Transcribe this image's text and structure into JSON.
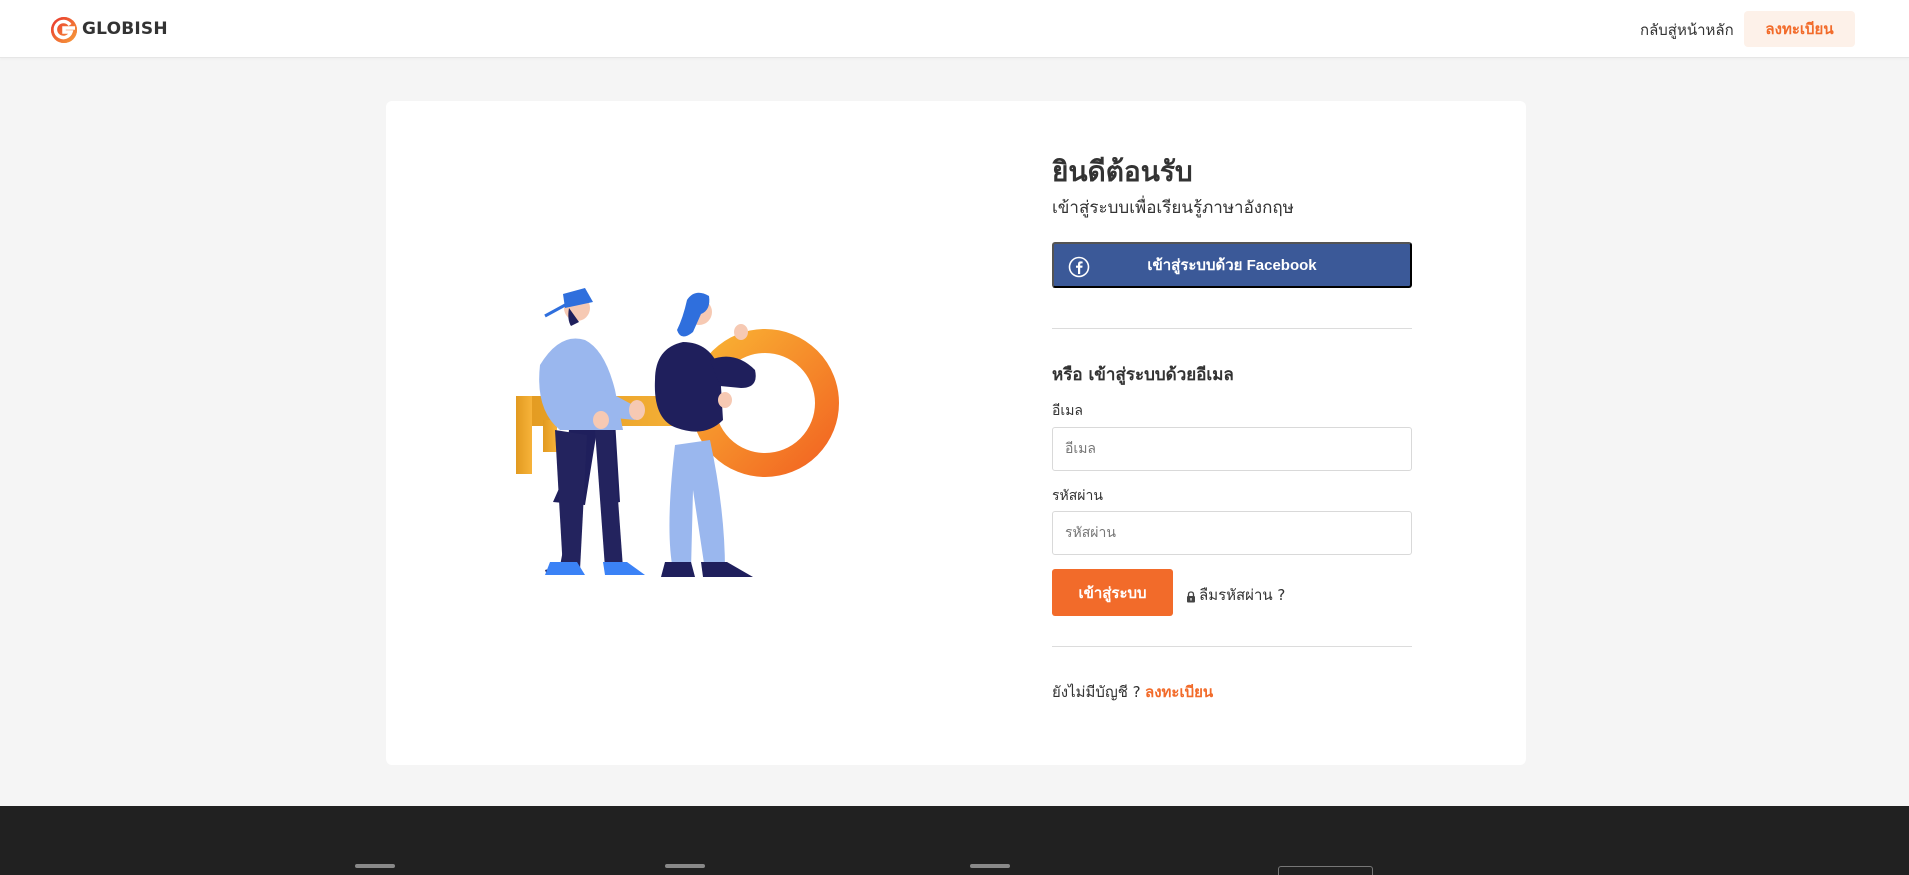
{
  "header": {
    "brand": "GLOBISH",
    "back_home": "กลับสู่หน้าหลัก",
    "register": "ลงทะเบียน"
  },
  "login": {
    "title": "ยินดีต้อนรับ",
    "subtitle": "เข้าสู่ระบบเพื่อเรียนรู้ภาษาอังกฤษ",
    "facebook_label": "เข้าสู่ระบบด้วย Facebook",
    "or_email": "หรือ เข้าสู่ระบบด้วยอีเมล",
    "email_label": "อีเมล",
    "email_placeholder": "อีเมล",
    "email_value": "",
    "password_label": "รหัสผ่าน",
    "password_placeholder": "รหัสผ่าน",
    "password_value": "",
    "submit_label": "เข้าสู่ระบบ",
    "forgot_label": "ลืมรหัสผ่าน ?",
    "no_account": "ยังไม่มีบัญชี ?",
    "register_link": "ลงทะเบียน"
  },
  "icons": {
    "brand_logo": "globish-logo-icon",
    "facebook": "facebook-icon",
    "lock": "lock-icon",
    "illustration": "people-with-key-illustration"
  },
  "colors": {
    "accent": "#f26b2a",
    "facebook": "#3b5998",
    "footer": "#212121",
    "background": "#f5f5f5"
  }
}
